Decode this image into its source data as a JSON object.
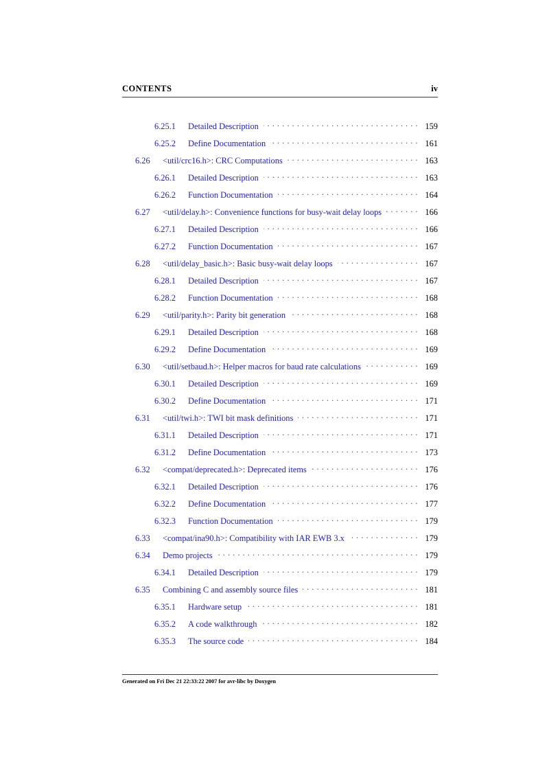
{
  "header": {
    "title": "CONTENTS",
    "folio": "iv"
  },
  "toc": {
    "entries": [
      {
        "level": 2,
        "number": "6.25.1",
        "label": "Detailed Description",
        "page": "159"
      },
      {
        "level": 2,
        "number": "6.25.2",
        "label": "Define Documentation",
        "page": "161"
      },
      {
        "level": 1,
        "number": "6.26",
        "label": "<util/crc16.h>: CRC Computations",
        "page": "163"
      },
      {
        "level": 2,
        "number": "6.26.1",
        "label": "Detailed Description",
        "page": "163"
      },
      {
        "level": 2,
        "number": "6.26.2",
        "label": "Function Documentation",
        "page": "164"
      },
      {
        "level": 1,
        "number": "6.27",
        "label": "<util/delay.h>: Convenience functions for busy-wait delay loops",
        "page": "166"
      },
      {
        "level": 2,
        "number": "6.27.1",
        "label": "Detailed Description",
        "page": "166"
      },
      {
        "level": 2,
        "number": "6.27.2",
        "label": "Function Documentation",
        "page": "167"
      },
      {
        "level": 1,
        "number": "6.28",
        "label": "<util/delay_basic.h>: Basic busy-wait delay loops",
        "page": "167"
      },
      {
        "level": 2,
        "number": "6.28.1",
        "label": "Detailed Description",
        "page": "167"
      },
      {
        "level": 2,
        "number": "6.28.2",
        "label": "Function Documentation",
        "page": "168"
      },
      {
        "level": 1,
        "number": "6.29",
        "label": "<util/parity.h>: Parity bit generation",
        "page": "168"
      },
      {
        "level": 2,
        "number": "6.29.1",
        "label": "Detailed Description",
        "page": "168"
      },
      {
        "level": 2,
        "number": "6.29.2",
        "label": "Define Documentation",
        "page": "169"
      },
      {
        "level": 1,
        "number": "6.30",
        "label": "<util/setbaud.h>: Helper macros for baud rate calculations",
        "page": "169"
      },
      {
        "level": 2,
        "number": "6.30.1",
        "label": "Detailed Description",
        "page": "169"
      },
      {
        "level": 2,
        "number": "6.30.2",
        "label": "Define Documentation",
        "page": "171"
      },
      {
        "level": 1,
        "number": "6.31",
        "label": "<util/twi.h>: TWI bit mask definitions",
        "page": "171"
      },
      {
        "level": 2,
        "number": "6.31.1",
        "label": "Detailed Description",
        "page": "171"
      },
      {
        "level": 2,
        "number": "6.31.2",
        "label": "Define Documentation",
        "page": "173"
      },
      {
        "level": 1,
        "number": "6.32",
        "label": "<compat/deprecated.h>: Deprecated items",
        "page": "176"
      },
      {
        "level": 2,
        "number": "6.32.1",
        "label": "Detailed Description",
        "page": "176"
      },
      {
        "level": 2,
        "number": "6.32.2",
        "label": "Define Documentation",
        "page": "177"
      },
      {
        "level": 2,
        "number": "6.32.3",
        "label": "Function Documentation",
        "page": "179"
      },
      {
        "level": 1,
        "number": "6.33",
        "label": "<compat/ina90.h>: Compatibility with IAR EWB 3.x",
        "page": "179"
      },
      {
        "level": 1,
        "number": "6.34",
        "label": "Demo projects",
        "page": "179"
      },
      {
        "level": 2,
        "number": "6.34.1",
        "label": "Detailed Description",
        "page": "179"
      },
      {
        "level": 1,
        "number": "6.35",
        "label": "Combining C and assembly source files",
        "page": "181"
      },
      {
        "level": 2,
        "number": "6.35.1",
        "label": "Hardware setup",
        "page": "181"
      },
      {
        "level": 2,
        "number": "6.35.2",
        "label": "A code walkthrough",
        "page": "182"
      },
      {
        "level": 2,
        "number": "6.35.3",
        "label": "The source code",
        "page": "184"
      }
    ]
  },
  "footer": {
    "text": "Generated on Fri Dec 21 22:33:22 2007 for avr-libc by Doxygen"
  },
  "colors": {
    "link": "#2222cc",
    "text": "#000000",
    "rule": "#3a3a3a",
    "background": "#ffffff"
  }
}
